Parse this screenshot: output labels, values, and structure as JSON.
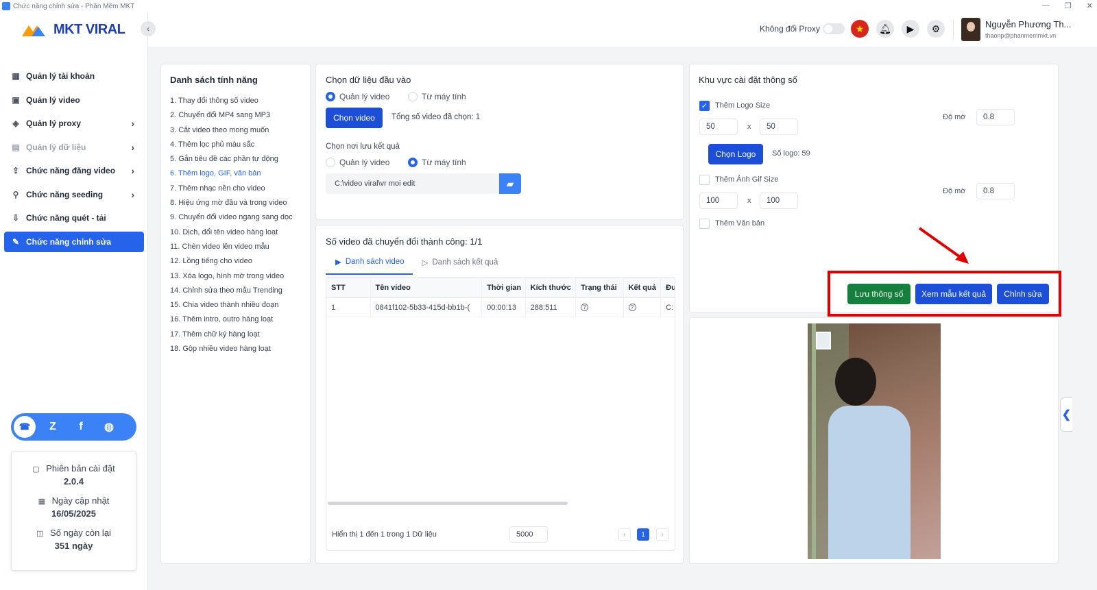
{
  "window": {
    "title": "Chức năng chỉnh sửa - Phần Mềm MKT",
    "controls": [
      "—",
      "❐",
      "✕"
    ]
  },
  "app": {
    "logo_text": "MKT VIRAL",
    "collapse_icon": "‹"
  },
  "sidebar": {
    "items": [
      {
        "label": "Quản lý tài khoản",
        "icon": "grid-icon",
        "chevron": ""
      },
      {
        "label": "Quản lý video",
        "icon": "video-icon",
        "chevron": ""
      },
      {
        "label": "Quản lý proxy",
        "icon": "layers-icon",
        "chevron": "›"
      },
      {
        "label": "Quản lý dữ liệu",
        "icon": "clipboard-icon",
        "chevron": "›"
      },
      {
        "label": "Chức năng đăng video",
        "icon": "upload-icon",
        "chevron": "›"
      },
      {
        "label": "Chức năng seeding",
        "icon": "share-icon",
        "chevron": "›"
      },
      {
        "label": "Chức năng quét - tải",
        "icon": "download-icon",
        "chevron": ""
      },
      {
        "label": "Chức năng chỉnh sửa",
        "icon": "pen-icon",
        "chevron": ""
      }
    ],
    "version": {
      "label1": "Phiên bản cài đặt",
      "value1": "2.0.4",
      "label2": "Ngày cập nhật",
      "value2": "16/05/2025",
      "label3": "Số ngày còn lại",
      "value3": "351 ngày"
    }
  },
  "header": {
    "proxy_label": "Không đổi Proxy",
    "user_name": "Nguyễn Phương Th...",
    "user_email": "thaonp@phanmemmkt.vn"
  },
  "features": {
    "title": "Danh sách tính năng",
    "items": [
      "1. Thay đổi thông số video",
      "2. Chuyển đổi MP4 sang MP3",
      "3. Cắt video theo mong muốn",
      "4. Thêm lọc phủ màu sắc",
      "5. Gắn tiêu đề các phần tự động",
      "6. Thêm logo, GIF, văn bản",
      "7. Thêm nhạc nền cho video",
      "8. Hiệu ứng mờ đầu và trong video",
      "9. Chuyển đổi video ngang sang dọc",
      "10. Dịch, đổi tên video hàng loạt",
      "11. Chèn video lên video mẫu",
      "12. Lồng tiếng cho video",
      "13. Xóa logo, hình mờ trong video",
      "14. Chỉnh sửa theo mẫu Trending",
      "15. Chia video thành nhiều đoạn",
      "16. Thêm intro, outro hàng loạt",
      "17. Thêm chữ ký hàng loạt",
      "18. Gộp nhiều video hàng loạt"
    ]
  },
  "input": {
    "title": "Chọn dữ liệu đầu vào",
    "opt1": "Quản lý video",
    "opt2": "Từ máy tính",
    "choose_btn": "Chọn video",
    "total": "Tổng số video đã chọn: 1",
    "save_title": "Chọn nơi lưu kết quả",
    "save_opt1": "Quản lý video",
    "save_opt2": "Từ máy tính",
    "path": "C:\\video viral\\vr moi edit"
  },
  "results": {
    "title": "Số video đã chuyển đổi thành công: 1/1",
    "tab1": "Danh sách video",
    "tab2": "Danh sách kết quả",
    "columns": [
      "STT",
      "Tên video",
      "Thời gian",
      "Kích thước",
      "Trạng thái",
      "Kết quả",
      "Đư"
    ],
    "rows": [
      [
        "1",
        "0841f102-5b33-415d-bb1b-(",
        "00:00:13",
        "288:511",
        "?",
        "?",
        "C:"
      ]
    ],
    "footer": "Hiển thị 1 đến 1 trong 1 Dữ liệu",
    "page_size": "5000",
    "page": "1",
    "prev": "‹",
    "next": "›"
  },
  "settings": {
    "title": "Khu vực cài đặt thông số",
    "logo_size_label": "Thêm Logo Size",
    "logo_w": "50",
    "logo_h": "50",
    "x": "x",
    "opacity_label": "Độ mờ",
    "opacity1": "0.8",
    "choose_logo": "Chọn Logo",
    "logo_count": "Số logo: 59",
    "gif_label": "Thêm Ảnh Gif Size",
    "gif_w": "100",
    "gif_h": "100",
    "opacity2": "0.8",
    "text_label": "Thêm Văn bản",
    "save_btn": "Lưu thông số",
    "preview_btn": "Xem mẫu kết quả",
    "edit_btn": "Chỉnh sửa"
  },
  "colors": {
    "primary": "#1d4ed8",
    "green": "#15803d",
    "highlight": "#e00000"
  }
}
